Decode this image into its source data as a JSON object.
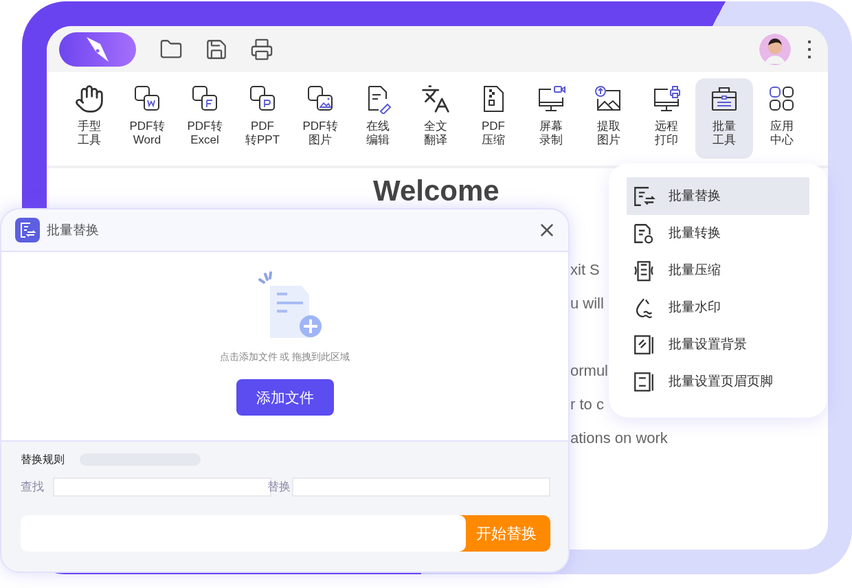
{
  "toolbar": {
    "items": [
      {
        "lines": [
          "手型",
          "工具"
        ],
        "selected": false
      },
      {
        "lines": [
          "PDF转",
          "Word"
        ],
        "selected": false
      },
      {
        "lines": [
          "PDF转",
          "Excel"
        ],
        "selected": false
      },
      {
        "lines": [
          "PDF",
          "转PPT"
        ],
        "selected": false
      },
      {
        "lines": [
          "PDF转",
          "图片"
        ],
        "selected": false
      },
      {
        "lines": [
          "在线",
          "编辑"
        ],
        "selected": false
      },
      {
        "lines": [
          "全文",
          "翻译"
        ],
        "selected": false
      },
      {
        "lines": [
          "PDF",
          "压缩"
        ],
        "selected": false
      },
      {
        "lines": [
          "屏幕",
          "录制"
        ],
        "selected": false
      },
      {
        "lines": [
          "提取",
          "图片"
        ],
        "selected": false
      },
      {
        "lines": [
          "远程",
          "打印"
        ],
        "selected": false
      },
      {
        "lines": [
          "批量",
          "工具"
        ],
        "selected": true
      },
      {
        "lines": [
          "应用",
          "中心"
        ],
        "selected": false
      }
    ]
  },
  "welcome": {
    "heading": "Welcome",
    "fragments": [
      "xit S",
      "u will",
      "ormul",
      "r to c",
      "ations on work"
    ]
  },
  "dialog": {
    "title": "批量替换",
    "hint": "点击添加文件 或 拖拽到此区域",
    "add_button": "添加文件",
    "rules_label": "替换规则",
    "find_label": "查找",
    "replace_label": "替换",
    "start_button": "开始替换"
  },
  "dropdown": {
    "items": [
      {
        "label": "批量替换",
        "selected": true
      },
      {
        "label": "批量转换",
        "selected": false
      },
      {
        "label": "批量压缩",
        "selected": false
      },
      {
        "label": "批量水印",
        "selected": false
      },
      {
        "label": "批量设置背景",
        "selected": false
      },
      {
        "label": "批量设置页眉页脚",
        "selected": false
      }
    ]
  }
}
